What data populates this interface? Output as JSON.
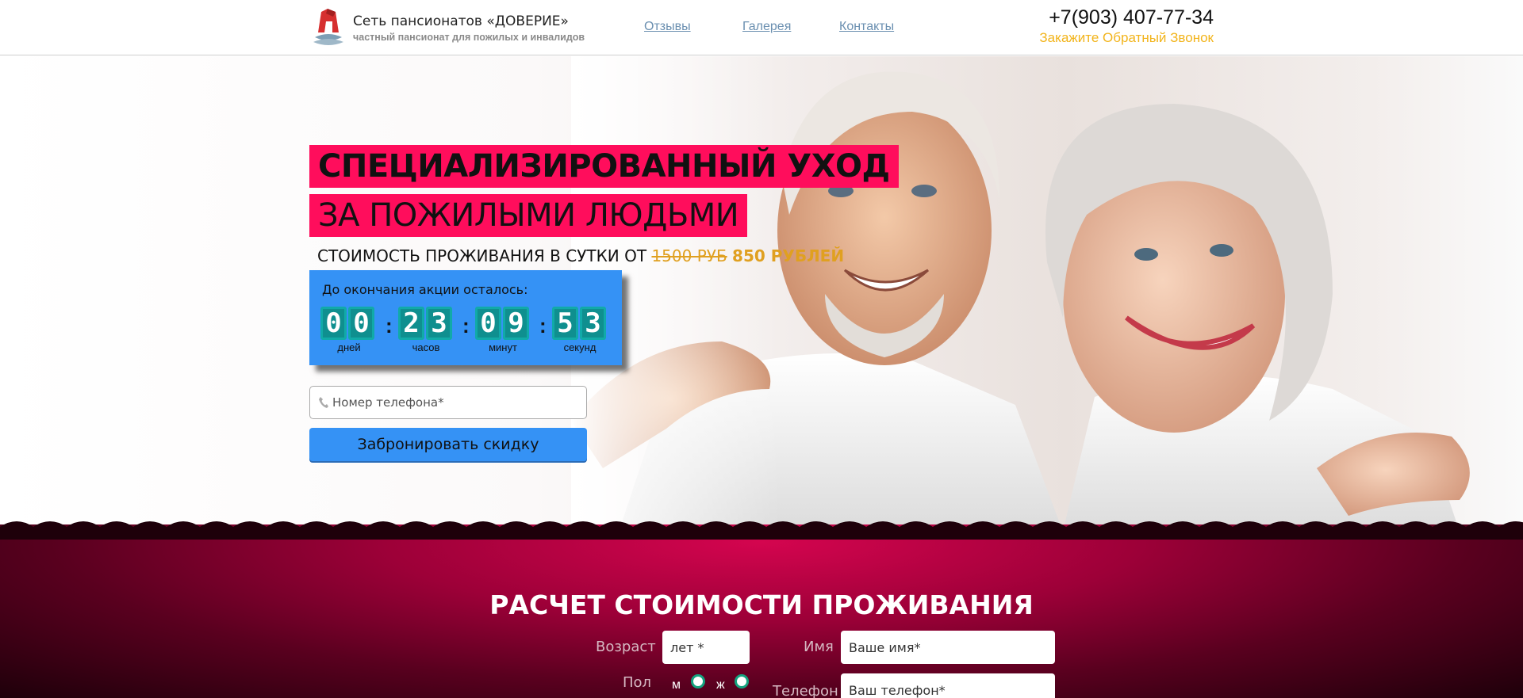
{
  "header": {
    "brand_title": "Сеть пансионатов «ДОВЕРИЕ»",
    "brand_subtitle": "частный пансионат для пожилых и инвалидов",
    "nav": [
      "Отзывы",
      "Галерея",
      "Контакты"
    ],
    "phone": "+7(903) 407-77-34",
    "callback": "Закажите Обратный Звонок"
  },
  "hero": {
    "headline_1": "СПЕЦИАЛИЗИРОВАННЫЙ УХОД",
    "headline_2": "ЗА ПОЖИЛЫМИ ЛЮДЬМИ",
    "price_prefix": "СТОИМОСТЬ ПРОЖИВАНИЯ В СУТКИ ОТ",
    "price_old": "1500 РУБ",
    "price_new": "850 РУБЛЕЙ"
  },
  "timer": {
    "title": "До окончания акции осталось:",
    "days": [
      "0",
      "0"
    ],
    "hours": [
      "2",
      "3"
    ],
    "minutes": [
      "0",
      "9"
    ],
    "seconds": [
      "5",
      "3"
    ],
    "labels": [
      "дней",
      "часов",
      "минут",
      "секунд"
    ]
  },
  "form": {
    "phone_placeholder": "Номер телефона*",
    "button": "Забронировать скидку"
  },
  "calc": {
    "title": "РАСЧЕТ СТОИМОСТИ ПРОЖИВАНИЯ",
    "age_label": "Возраст",
    "age_placeholder": "лет *",
    "name_label": "Имя",
    "name_placeholder": "Ваше имя*",
    "sex_label": "Пол",
    "sex_m": "м",
    "sex_f": "ж",
    "phone_label": "Телефон",
    "phone_placeholder": "Ваш телефон*"
  },
  "colors": {
    "accent_pink": "#ff0d5c",
    "accent_blue": "#3592f5",
    "price_gold": "#e0a020",
    "callback_yellow": "#f2b41b",
    "timer_teal": "#0f8f8f"
  }
}
